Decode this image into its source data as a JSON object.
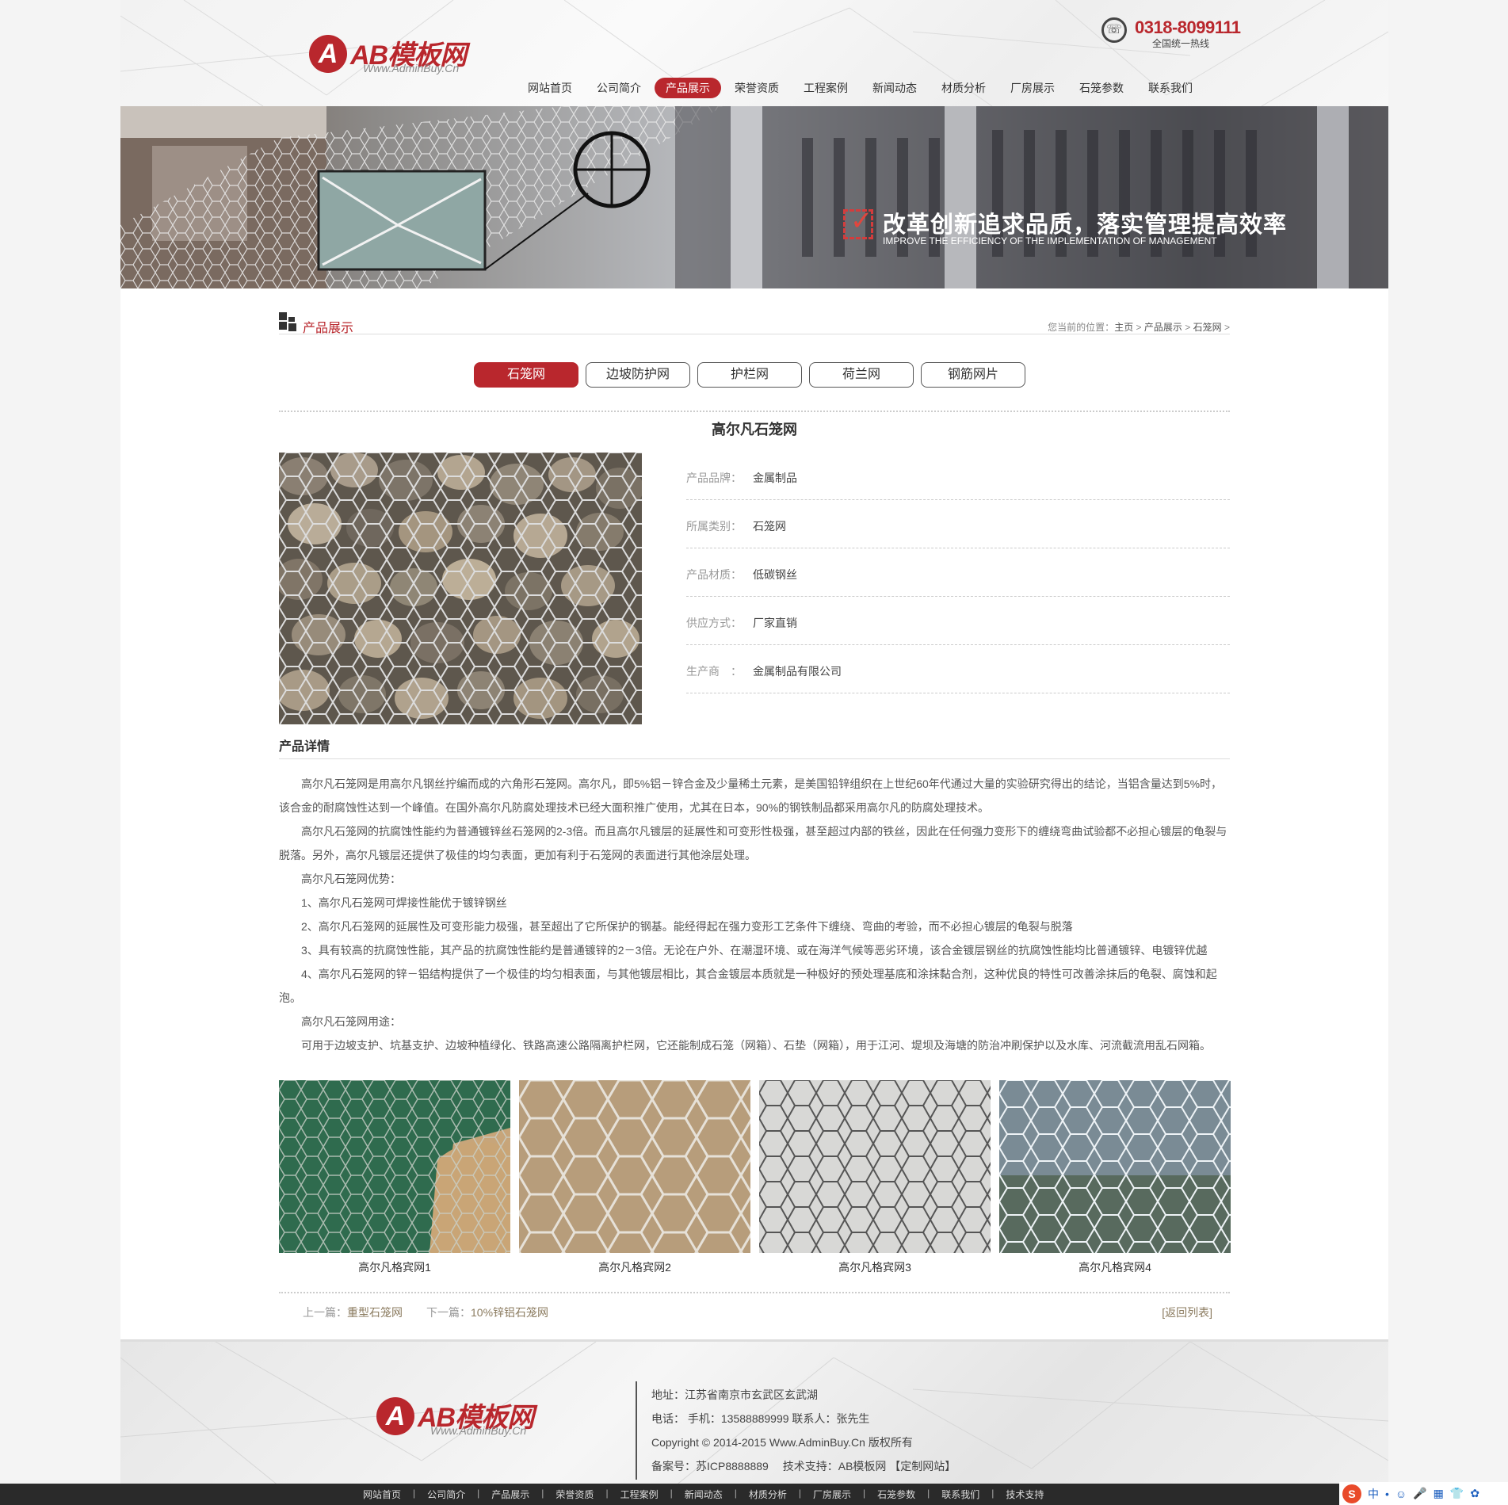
{
  "header": {
    "logo_text": "AB模板网",
    "logo_letter": "A",
    "logo_url": "Www.AdminBuy.Cn",
    "hotline_number": "0318-8099111",
    "hotline_label": "全国统一热线"
  },
  "nav": {
    "items": [
      {
        "label": "网站首页",
        "active": false
      },
      {
        "label": "公司简介",
        "active": false
      },
      {
        "label": "产品展示",
        "active": true
      },
      {
        "label": "荣誉资质",
        "active": false
      },
      {
        "label": "工程案例",
        "active": false
      },
      {
        "label": "新闻动态",
        "active": false
      },
      {
        "label": "材质分析",
        "active": false
      },
      {
        "label": "厂房展示",
        "active": false
      },
      {
        "label": "石笼参数",
        "active": false
      },
      {
        "label": "联系我们",
        "active": false
      }
    ]
  },
  "banner": {
    "title": "改革创新追求品质，落实管理提高效率",
    "subtitle": "IMPROVE THE EFFICIENCY OF THE IMPLEMENTATION OF MANAGEMENT"
  },
  "section": {
    "title": "产品展示",
    "breadcrumb_prefix": "您当前的位置：",
    "breadcrumb": [
      "主页",
      "产品展示",
      "石笼网"
    ],
    "breadcrumb_sep": ">"
  },
  "categories": [
    {
      "label": "石笼网",
      "active": true
    },
    {
      "label": "边坡防护网",
      "active": false
    },
    {
      "label": "护栏网",
      "active": false
    },
    {
      "label": "荷兰网",
      "active": false
    },
    {
      "label": "钢筋网片",
      "active": false
    }
  ],
  "product": {
    "title": "高尔凡石笼网",
    "attributes": [
      {
        "key": "产品品牌：",
        "value": "金属制品"
      },
      {
        "key": "所属类别：",
        "value": "石笼网"
      },
      {
        "key": "产品材质：",
        "value": "低碳钢丝"
      },
      {
        "key": "供应方式：",
        "value": "厂家直销"
      },
      {
        "key": "生产商　：",
        "value": "金属制品有限公司"
      }
    ]
  },
  "detail": {
    "heading": "产品详情",
    "paragraphs": [
      "高尔凡石笼网是用高尔凡钢丝拧编而成的六角形石笼网。高尔凡，即5%铝－锌合金及少量稀土元素，是美国铅锌组织在上世纪60年代通过大量的实验研究得出的结论，当铝含量达到5%时，该合金的耐腐蚀性达到一个峰值。在国外高尔凡防腐处理技术已经大面积推广使用，尤其在日本，90%的钢铁制品都采用高尔凡的防腐处理技术。",
      "高尔凡石笼网的抗腐蚀性能约为普通镀锌丝石笼网的2-3倍。而且高尔凡镀层的延展性和可变形性极强，甚至超过内部的铁丝，因此在任何强力变形下的缠绕弯曲试验都不必担心镀层的龟裂与脱落。另外，高尔凡镀层还提供了极佳的均匀表面，更加有利于石笼网的表面进行其他涂层处理。",
      "高尔凡石笼网优势：",
      "1、高尔凡石笼网可焊接性能优于镀锌钢丝",
      "2、高尔凡石笼网的延展性及可变形能力极强，甚至超出了它所保护的钢基。能经得起在强力变形工艺条件下缠绕、弯曲的考验，而不必担心镀层的龟裂与脱落",
      "3、具有较高的抗腐蚀性能，其产品的抗腐蚀性能约是普通镀锌的2－3倍。无论在户外、在潮湿环境、或在海洋气候等恶劣环境，该合金镀层钢丝的抗腐蚀性能均比普通镀锌、电镀锌优越",
      "4、高尔凡石笼网的锌－铝结构提供了一个极佳的均匀相表面，与其他镀层相比，其合金镀层本质就是一种极好的预处理基底和涂抹黏合剂，这种优良的特性可改善涂抹后的龟裂、腐蚀和起泡。",
      "高尔凡石笼网用途：",
      "可用于边坡支护、坑基支护、边坡种植绿化、铁路高速公路隔离护栏网，它还能制成石笼（网箱）、石垫（网箱），用于江河、堤坝及海塘的防治冲刷保护以及水库、河流截流用乱石网箱。"
    ]
  },
  "gallery": [
    {
      "caption": "高尔凡格宾网1"
    },
    {
      "caption": "高尔凡格宾网2"
    },
    {
      "caption": "高尔凡格宾网3"
    },
    {
      "caption": "高尔凡格宾网4"
    }
  ],
  "pager": {
    "prev_label": "上一篇：",
    "prev_title": "重型石笼网",
    "next_label": "下一篇：",
    "next_title": "10%锌铝石笼网",
    "back": "[返回列表]"
  },
  "footer": {
    "address": "地址：江苏省南京市玄武区玄武湖",
    "phone": "电话： 手机：13588889999 联系人：张先生",
    "copyright": "Copyright © 2014-2015 Www.AdminBuy.Cn 版权所有",
    "icp": "备案号：苏ICP8888889　 技术支持：AB模板网 【定制网站】"
  },
  "bottom_nav": [
    "网站首页",
    "公司简介",
    "产品展示",
    "荣誉资质",
    "工程案例",
    "新闻动态",
    "材质分析",
    "厂房展示",
    "石笼参数",
    "联系我们",
    "技术支持"
  ],
  "ime": {
    "letter": "S",
    "items": [
      "中",
      "•",
      "☺",
      "🎤",
      "▦",
      "👕",
      "✿"
    ]
  },
  "colors": {
    "accent": "#b9272d"
  }
}
